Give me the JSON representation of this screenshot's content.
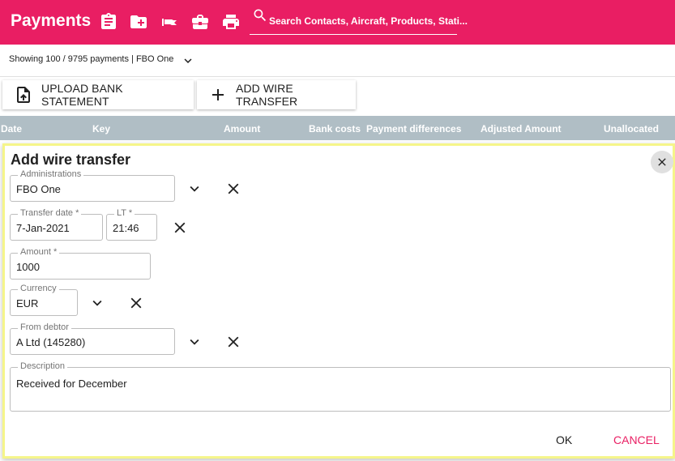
{
  "header": {
    "title": "Payments",
    "search_placeholder": "Search Contacts, Aircraft, Products, Stati...",
    "icons": [
      "clipboard-icon",
      "folder-add-icon",
      "flag-icon",
      "briefcase-icon",
      "printer-icon",
      "search-icon"
    ]
  },
  "subheader": {
    "showing": "Showing 100 / 9795 payments | FBO One"
  },
  "toolbar": {
    "upload_label": "UPLOAD BANK STATEMENT",
    "add_wire_label": "ADD WIRE TRANSFER"
  },
  "table": {
    "columns": [
      "Date",
      "Key",
      "Amount",
      "Bank costs",
      "Payment differences",
      "Adjusted Amount",
      "Unallocated"
    ]
  },
  "dialog": {
    "title": "Add wire transfer",
    "administrations": {
      "label": "Administrations",
      "value": "FBO One"
    },
    "transfer_date": {
      "label": "Transfer date *",
      "value": "7-Jan-2021"
    },
    "lt": {
      "label": "LT *",
      "value": "21:46"
    },
    "amount": {
      "label": "Amount *",
      "value": "1000"
    },
    "currency": {
      "label": "Currency",
      "value": "EUR"
    },
    "from_debtor": {
      "label": "From debtor",
      "value": "A Ltd (145280)"
    },
    "description": {
      "label": "Description",
      "value": "Received for December"
    },
    "ok_label": "OK",
    "cancel_label": "CANCEL"
  },
  "colors": {
    "accent": "#e91e63",
    "table_header": "#b0bec5",
    "dialog_border": "#f5f58a"
  }
}
